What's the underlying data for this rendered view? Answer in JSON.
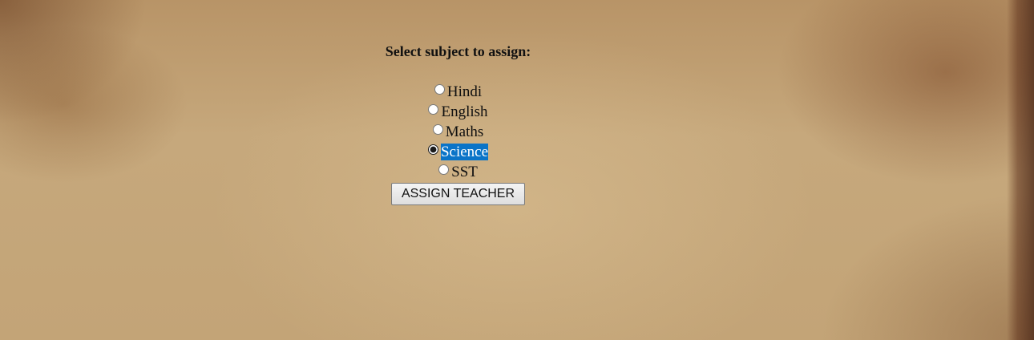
{
  "form": {
    "heading": "Select subject to assign:",
    "options": [
      {
        "label": "Hindi",
        "selected": false
      },
      {
        "label": "English",
        "selected": false
      },
      {
        "label": "Maths",
        "selected": false
      },
      {
        "label": "Science",
        "selected": true
      },
      {
        "label": "SST",
        "selected": false
      }
    ],
    "submit_label": "ASSIGN TEACHER"
  }
}
